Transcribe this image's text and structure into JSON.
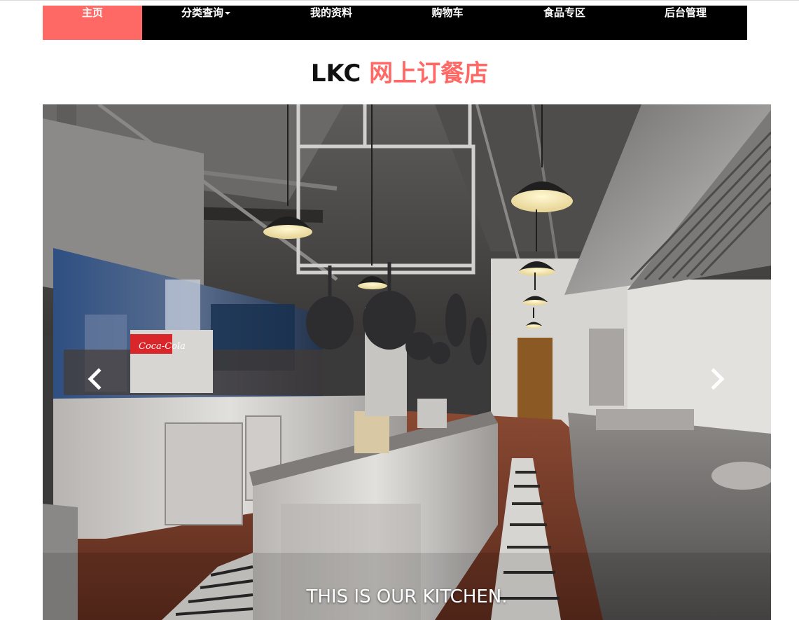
{
  "nav": {
    "items": [
      {
        "label": "主页",
        "active": true
      },
      {
        "label": "分类查询",
        "dropdown": true
      },
      {
        "label": "我的资料"
      },
      {
        "label": "购物车"
      },
      {
        "label": "食品专区"
      },
      {
        "label": "后台管理"
      }
    ]
  },
  "header": {
    "brand": "LKC",
    "subtitle": "网上订餐店"
  },
  "carousel": {
    "caption": "THIS IS OUR KITCHEN.",
    "prev_icon": "chevron-left-icon",
    "next_icon": "chevron-right-icon"
  },
  "colors": {
    "accent": "#fe6966",
    "navbar": "#000000"
  }
}
